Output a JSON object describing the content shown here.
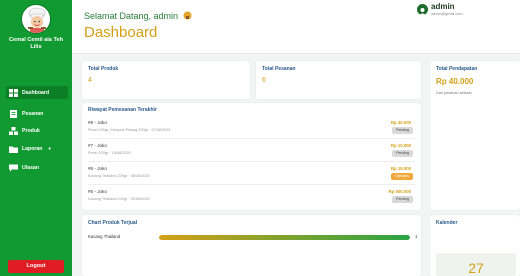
{
  "sidebar": {
    "brand": "Cemal Cemil ala Teh Lilis",
    "items": [
      {
        "label": "Dashboard",
        "active": true,
        "icon": "grid-icon"
      },
      {
        "label": "Pesanan",
        "active": false,
        "icon": "receipt-icon"
      },
      {
        "label": "Produk",
        "active": false,
        "icon": "boxes-icon"
      },
      {
        "label": "Laporan",
        "active": false,
        "icon": "folder-icon",
        "caret": "▾"
      },
      {
        "label": "Ulasan",
        "active": false,
        "icon": "chat-icon"
      }
    ],
    "logout": "Logout"
  },
  "header": {
    "greeting": "Selamat Datang, admin",
    "title": "Dashboard",
    "user_name": "admin",
    "user_email": "admin@gmail.com"
  },
  "stats": {
    "produk": {
      "label": "Total Produk",
      "value": "4"
    },
    "pesanan": {
      "label": "Total Pesanan",
      "value": "6"
    },
    "pendapatan": {
      "label": "Total Pendapatan",
      "value": "Rp 40.000",
      "note": "Dari pesanan selesai"
    }
  },
  "orders": {
    "title": "Riwayat Pemesanan Terakhir",
    "rows": [
      {
        "id": "#8 - Joko",
        "desc": "Pecel 100gr; Kerupuk Pisang 200gr · 27/08/2025",
        "price": "Rp 40.000",
        "status": "Pending"
      },
      {
        "id": "#7 - Joko",
        "desc": "Pecel 100gr · 14/08/2025",
        "price": "Rp 10.000",
        "status": "Pending"
      },
      {
        "id": "#6 - Joko",
        "desc": "Kacang Thailand 200gr · 08/08/2025",
        "price": "Rp 15.000",
        "status": "Diproses"
      },
      {
        "id": "#5 - Joko",
        "desc": "Kacang Thailand 100gr · 02/08/2025",
        "price": "Rp 500.000",
        "status": "Pending"
      }
    ]
  },
  "chart": {
    "title": "Chart Produk Terjual"
  },
  "calendar": {
    "title": "Kalender",
    "day": "27"
  },
  "chart_data": {
    "type": "bar",
    "categories": [
      "Kacang Thailand"
    ],
    "values": [
      1
    ],
    "xlim": [
      0,
      1
    ]
  }
}
